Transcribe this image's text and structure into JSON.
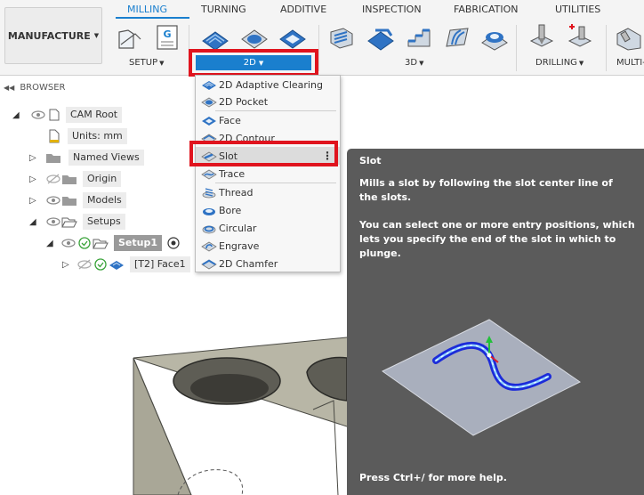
{
  "toolbar": {
    "workspace": "MANUFACTURE",
    "tabs": [
      "MILLING",
      "TURNING",
      "ADDITIVE",
      "INSPECTION",
      "FABRICATION",
      "UTILITIES"
    ],
    "active_tab": "MILLING",
    "groups": {
      "setup": "SETUP",
      "two_d": "2D",
      "three_d": "3D",
      "drilling": "DRILLING",
      "multi": "MULTI-"
    },
    "accent_color": "#1a7fce",
    "highlight_color": "#e0141e"
  },
  "browser": {
    "header": "BROWSER",
    "items": {
      "cam_root": "CAM Root",
      "units": "Units: mm",
      "named_views": "Named Views",
      "origin": "Origin",
      "models": "Models",
      "setups": "Setups",
      "setup1": "Setup1",
      "op1": "[T2] Face1"
    }
  },
  "menu": {
    "items": [
      {
        "label": "2D Adaptive Clearing",
        "icon": "adaptive-clearing-icon"
      },
      {
        "label": "2D Pocket",
        "icon": "pocket-icon"
      },
      {
        "label": "Face",
        "icon": "face-icon"
      },
      {
        "label": "2D Contour",
        "icon": "contour-icon"
      },
      {
        "label": "Slot",
        "icon": "slot-icon"
      },
      {
        "label": "Trace",
        "icon": "trace-icon"
      },
      {
        "label": "Thread",
        "icon": "thread-icon"
      },
      {
        "label": "Bore",
        "icon": "bore-icon"
      },
      {
        "label": "Circular",
        "icon": "circular-icon"
      },
      {
        "label": "Engrave",
        "icon": "engrave-icon"
      },
      {
        "label": "2D Chamfer",
        "icon": "chamfer-icon"
      }
    ],
    "hovered": "Slot",
    "more_glyph": "⋮"
  },
  "tooltip": {
    "title": "Slot",
    "description1": "Mills a slot by following the slot center line of the slots.",
    "description2": "You can select one or more entry positions, which lets you specify the end of the slot in which to plunge.",
    "help": "Press Ctrl+/ for more help."
  }
}
